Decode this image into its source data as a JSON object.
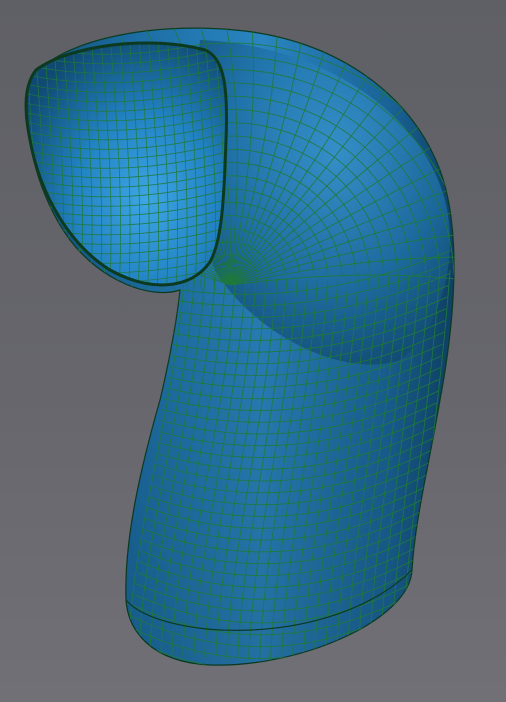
{
  "viewport": {
    "background_color": "#66666b",
    "surface_color": "#1f6fa3",
    "mesh_color": "#1f7a3a"
  },
  "model": {
    "name": "pipe-elbow-mesh",
    "shading": "smooth",
    "wireframe_overlay": true
  }
}
